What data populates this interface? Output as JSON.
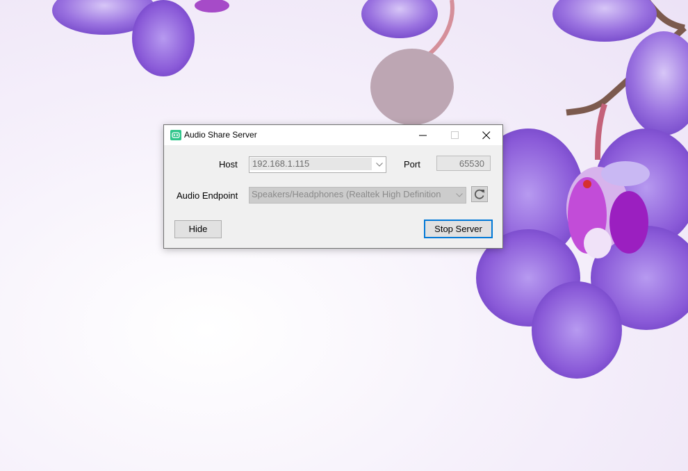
{
  "window": {
    "title": "Audio Share Server"
  },
  "form": {
    "host_label": "Host",
    "host_value": "192.168.1.115",
    "port_label": "Port",
    "port_value": "65530",
    "endpoint_label": "Audio Endpoint",
    "endpoint_value": "Speakers/Headphones (Realtek High Definition"
  },
  "buttons": {
    "hide_label": "Hide",
    "stop_label": "Stop Server"
  },
  "icons": {
    "app": "audio-share-icon",
    "minimize": "minimize-icon",
    "maximize": "maximize-icon",
    "close": "close-icon",
    "refresh": "refresh-icon",
    "dropdown": "chevron-down-icon"
  },
  "colors": {
    "accent": "#0078d7",
    "app_icon": "#2fc58a",
    "orchid": "#8a5ad8"
  }
}
